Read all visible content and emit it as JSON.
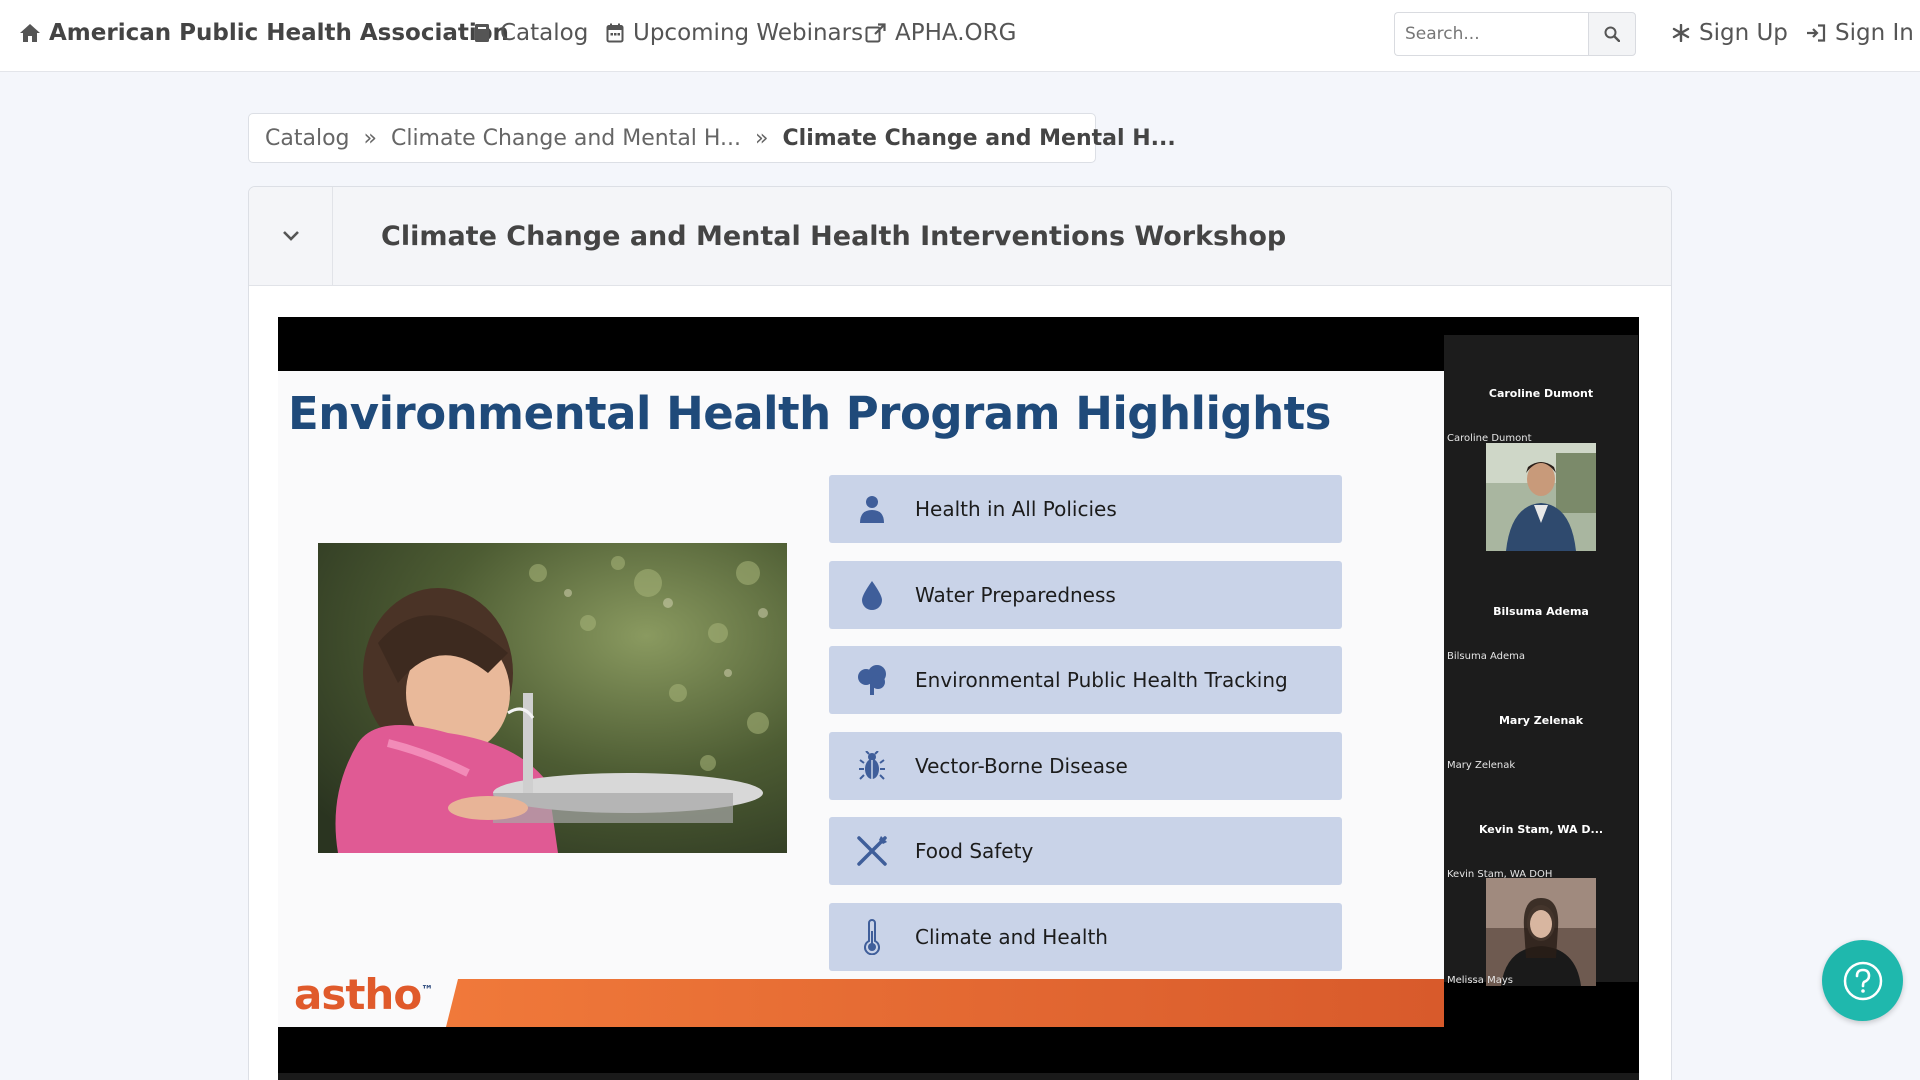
{
  "nav": {
    "brand": "American Public Health Association",
    "catalog": "Catalog",
    "webinars": "Upcoming Webinars",
    "apha": "APHA.ORG",
    "search_placeholder": "Search...",
    "signup": "Sign Up",
    "signin": "Sign In"
  },
  "breadcrumb": {
    "items": [
      "Catalog",
      "Climate Change and Mental H...",
      "Climate Change and Mental H..."
    ]
  },
  "card": {
    "title": "Climate Change and Mental Health Interventions Workshop"
  },
  "slide": {
    "title": "Environmental Health Program Highlights",
    "items": [
      {
        "icon": "person-icon",
        "label": "Health in All Policies"
      },
      {
        "icon": "water-drop-icon",
        "label": "Water Preparedness"
      },
      {
        "icon": "tree-icon",
        "label": "Environmental Public Health Tracking"
      },
      {
        "icon": "bug-icon",
        "label": "Vector-Borne Disease"
      },
      {
        "icon": "utensils-icon",
        "label": "Food Safety"
      },
      {
        "icon": "thermometer-icon",
        "label": "Climate and Health"
      }
    ],
    "logo_main": "astho",
    "logo_tm": "™"
  },
  "participants": [
    {
      "name": "Caroline Dumont",
      "label": "Caroline Dumont"
    },
    {
      "name": "Bilsuma Adema",
      "label": "Bilsuma Adema"
    },
    {
      "name": "Mary Zelenak",
      "label": "Mary Zelenak"
    },
    {
      "name": "Kevin Stam, WA D...",
      "label": "Kevin Stam, WA DOH"
    },
    {
      "label": "Melissa Mays"
    }
  ],
  "colors": {
    "accent": "#1fb8ad",
    "slide_title": "#1f4a7a",
    "item_bg": "#c9d3e8",
    "orange": "#f0793a"
  }
}
